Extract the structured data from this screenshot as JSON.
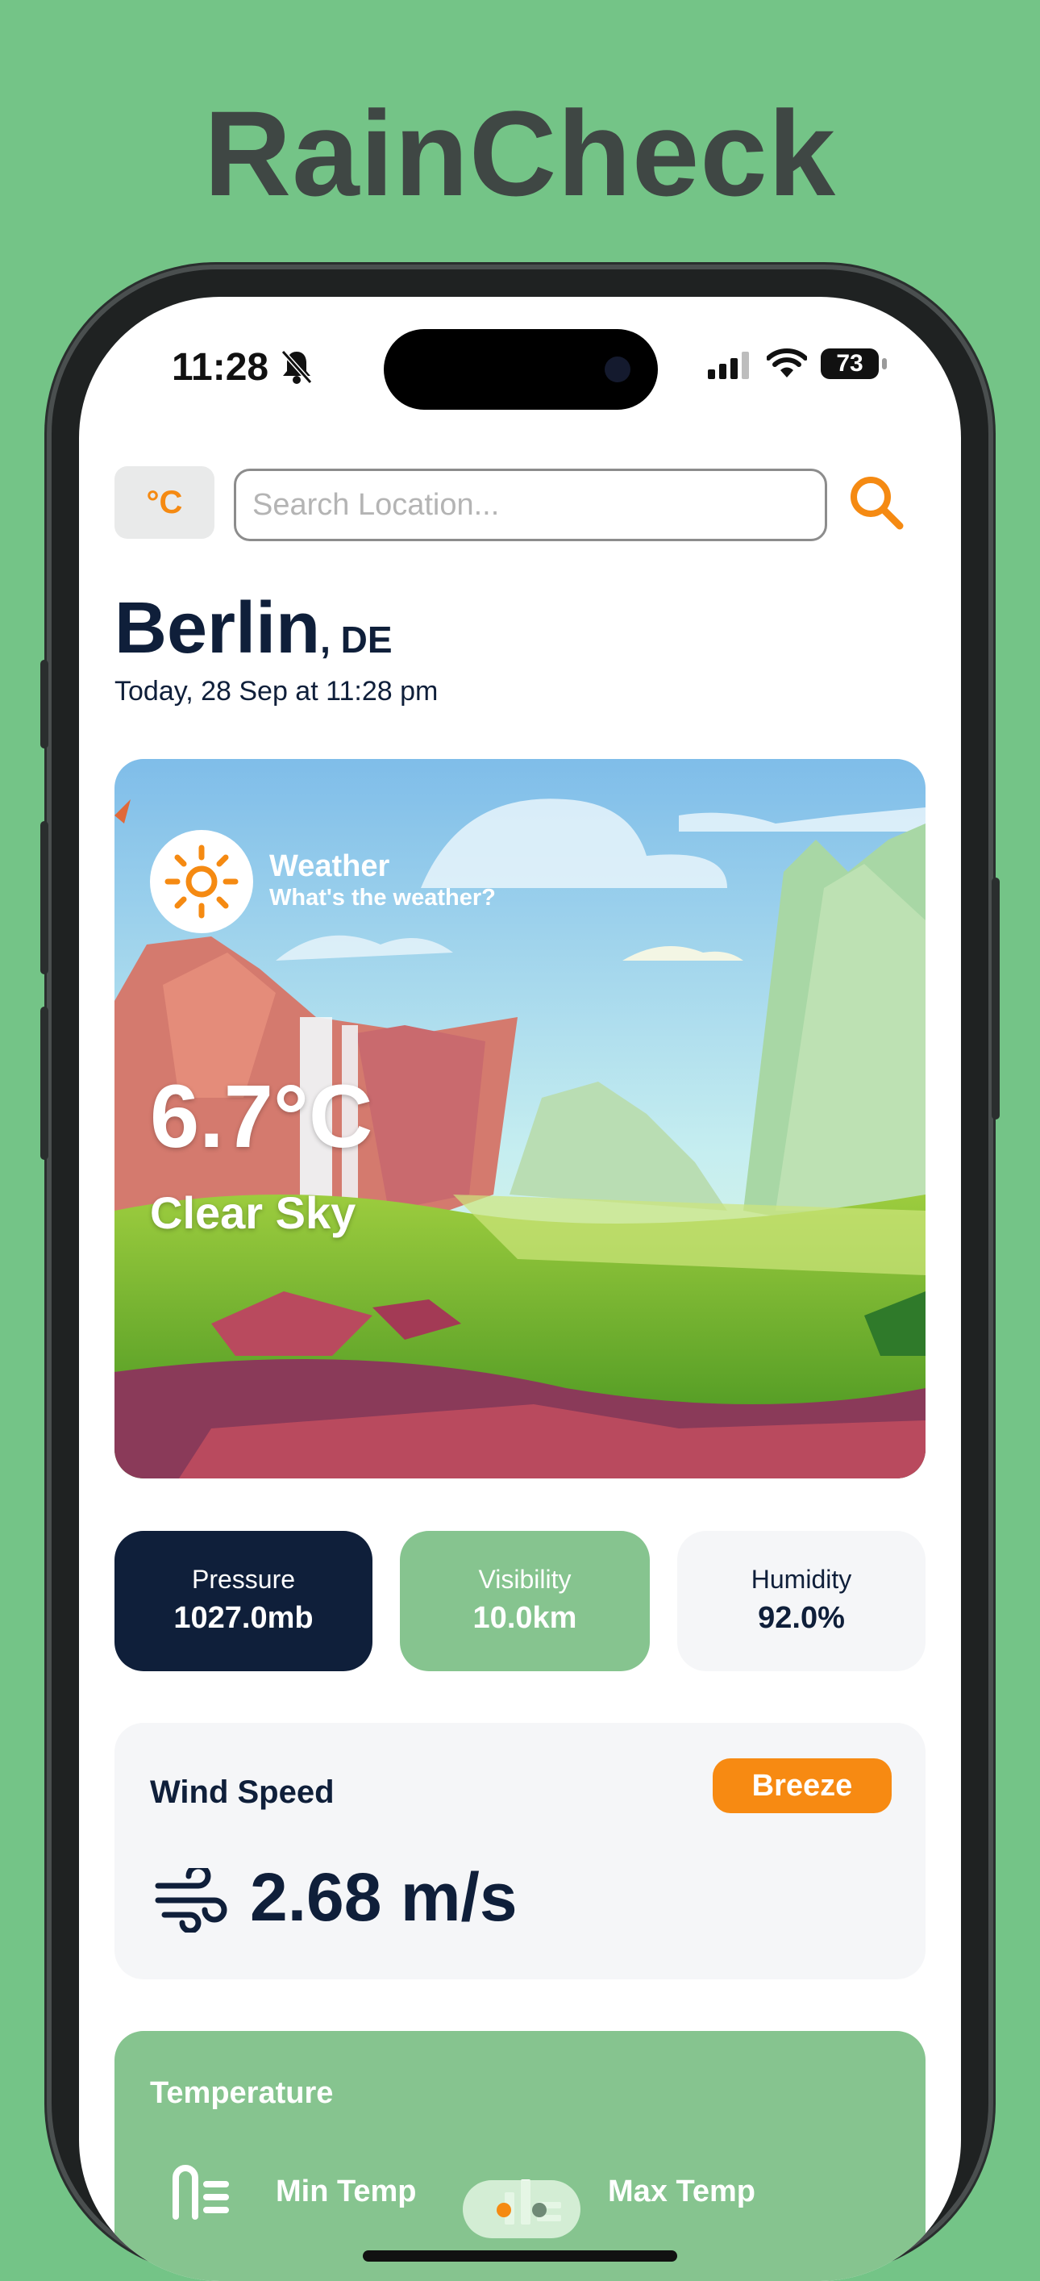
{
  "promo": {
    "title": "RainCheck"
  },
  "status_bar": {
    "time": "11:28",
    "battery": "73"
  },
  "search": {
    "unit_label": "°C",
    "placeholder": "Search Location..."
  },
  "location": {
    "city": "Berlin",
    "country": ", DE",
    "date": "Today, 28 Sep at 11:28 pm"
  },
  "hero": {
    "title": "Weather",
    "subtitle": "What's the weather?",
    "temperature": "6.7°C",
    "condition": "Clear Sky"
  },
  "stats": [
    {
      "label": "Pressure",
      "value": "1027.0mb"
    },
    {
      "label": "Visibility",
      "value": "10.0km"
    },
    {
      "label": "Humidity",
      "value": "92.0%"
    }
  ],
  "wind": {
    "title": "Wind Speed",
    "badge": "Breeze",
    "value": "2.68 m/s"
  },
  "temperature_card": {
    "title": "Temperature",
    "min_label": "Min Temp",
    "max_label": "Max Temp"
  },
  "pager": {
    "active": 1,
    "count": 2
  },
  "colors": {
    "accent": "#f58a12",
    "navy": "#0f1f3a",
    "green": "#86c48f",
    "background": "#74c487"
  }
}
